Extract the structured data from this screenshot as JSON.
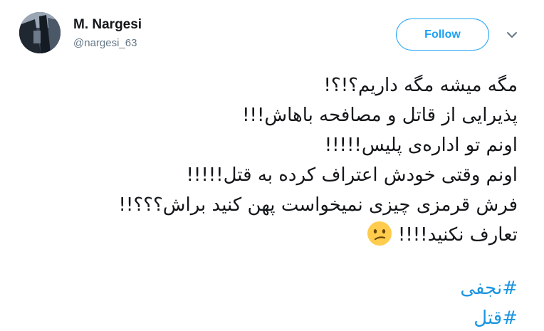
{
  "user": {
    "display_name": "M. Nargesi",
    "handle": "@nargesi_63"
  },
  "actions": {
    "follow_label": "Follow",
    "menu_icon": "chevron-down-icon"
  },
  "colors": {
    "accent": "#1da1f2",
    "hashtag": "#1b95e0",
    "secondary_text": "#657786",
    "primary_text": "#14171a"
  },
  "tweet": {
    "lines": [
      "مگه میشه مگه داریم؟!؟!",
      "پذیرایی از قاتل و مصافحه باهاش!!!",
      "اونم تو اداره‌ی پلیس!!!!!",
      "اونم وقتی خودش اعتراف کرده به قتل!!!!!",
      "فرش قرمزی چیزی نمیخواست پهن کنید براش؟؟؟!!",
      "تعارف نکنید!!!!"
    ],
    "emoji": "confused-face-icon",
    "hashtags": [
      "#نجفی",
      "#قتل"
    ]
  }
}
